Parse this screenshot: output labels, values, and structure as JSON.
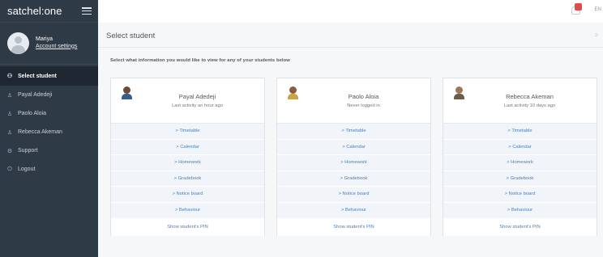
{
  "app": {
    "brand": "satchel:one"
  },
  "profile": {
    "name": "Mariya",
    "account_link": "Account settings"
  },
  "sidebar": {
    "items": [
      {
        "label": "Select student",
        "icon": "students-icon",
        "active": true
      },
      {
        "label": "Payal Adedeji",
        "icon": "person-icon",
        "active": false
      },
      {
        "label": "Paolo Aloia",
        "icon": "person-icon",
        "active": false
      },
      {
        "label": "Rebecca Akeman",
        "icon": "person-icon",
        "active": false
      },
      {
        "label": "Support",
        "icon": "support-icon",
        "active": false
      },
      {
        "label": "Logout",
        "icon": "power-icon",
        "active": false
      }
    ]
  },
  "topbar": {
    "language": "EN"
  },
  "page": {
    "title": "Select student",
    "instruction": "Select what information you would like to view for any of your students below"
  },
  "students": [
    {
      "name": "Payal Adedeji",
      "activity": "Last activity an hour ago",
      "links": [
        "> Timetable",
        "> Calendar",
        "> Homework",
        "> Gradebook",
        "> Notice board",
        "> Behaviour"
      ],
      "pin_link": "Show student's PIN"
    },
    {
      "name": "Paolo Aloia",
      "activity": "Never logged in",
      "links": [
        "> Timetable",
        "> Calendar",
        "> Homework",
        "> Gradebook",
        "> Notice board",
        "> Behaviour"
      ],
      "pin_link": "Show student's PIN"
    },
    {
      "name": "Rebecca Akeman",
      "activity": "Last activity 10 days ago",
      "links": [
        "> Timetable",
        "> Calendar",
        "> Homework",
        "> Gradebook",
        "> Notice board",
        "> Behaviour"
      ],
      "pin_link": "Show student's PIN"
    }
  ],
  "colors": {
    "sidebar": "#2f3a47",
    "link": "#4a7dbb",
    "badge": "#e14b4b"
  }
}
